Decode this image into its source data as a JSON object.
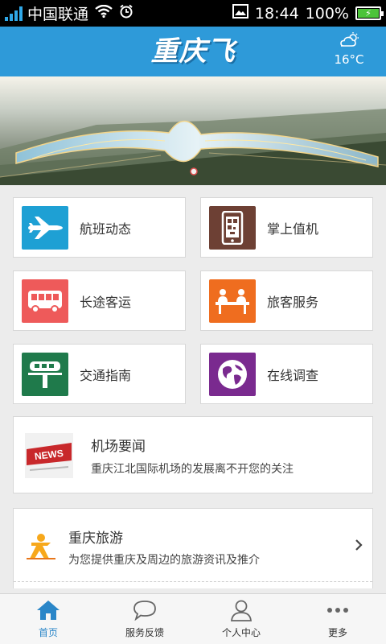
{
  "status_bar": {
    "carrier": "中国联通",
    "time": "18:44",
    "battery": "100%"
  },
  "header": {
    "logo_text": "重庆飞",
    "weather_icon": "partly-cloudy-icon",
    "temperature": "16°C"
  },
  "tiles": [
    {
      "label": "航班动态",
      "icon": "airplane-icon",
      "color": "#1ea0d4"
    },
    {
      "label": "掌上值机",
      "icon": "mobile-phone-icon",
      "color": "#6d4034"
    },
    {
      "label": "长途客运",
      "icon": "bus-icon",
      "color": "#ee5a5a"
    },
    {
      "label": "旅客服务",
      "icon": "service-desk-icon",
      "color": "#ef6d1f"
    },
    {
      "label": "交通指南",
      "icon": "monorail-icon",
      "color": "#1f7a4b"
    },
    {
      "label": "在线调查",
      "icon": "globe-icon",
      "color": "#7a2a8f"
    }
  ],
  "news": {
    "icon_text": "NEWS",
    "title": "机场要闻",
    "subtitle": "重庆江北国际机场的发展离不开您的关注"
  },
  "travel": {
    "title": "重庆旅游",
    "subtitle": "为您提供重庆及周边的旅游资讯及推介"
  },
  "bottom_nav": [
    {
      "label": "首页",
      "icon": "home-icon",
      "active": true
    },
    {
      "label": "服务反馈",
      "icon": "chat-bubble-icon",
      "active": false
    },
    {
      "label": "个人中心",
      "icon": "user-icon",
      "active": false
    },
    {
      "label": "更多",
      "icon": "more-dots-icon",
      "active": false
    }
  ]
}
